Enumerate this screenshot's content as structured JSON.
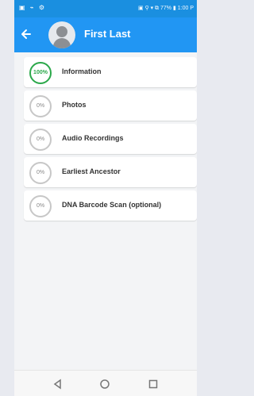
{
  "statusbar": {
    "left": "▣ ⌁ ⚙",
    "right": "▣ ⚲ ▾ ⧉ 77% ▮ 1:00 P"
  },
  "appbar": {
    "title": "First Last"
  },
  "items": [
    {
      "percent": "100%",
      "label": "Information",
      "complete": true
    },
    {
      "percent": "0%",
      "label": "Photos",
      "complete": false
    },
    {
      "percent": "0%",
      "label": "Audio Recordings",
      "complete": false
    },
    {
      "percent": "0%",
      "label": "Earliest Ancestor",
      "complete": false
    },
    {
      "percent": "0%",
      "label": "DNA Barcode Scan (optional)",
      "complete": false
    }
  ],
  "icons": {
    "back": "arrow-left",
    "nav_back": "triangle-left",
    "nav_home": "circle",
    "nav_recent": "square"
  },
  "colors": {
    "appbar": "#2196f3",
    "statusbar": "#1a8fe0",
    "complete": "#2ba84a"
  }
}
